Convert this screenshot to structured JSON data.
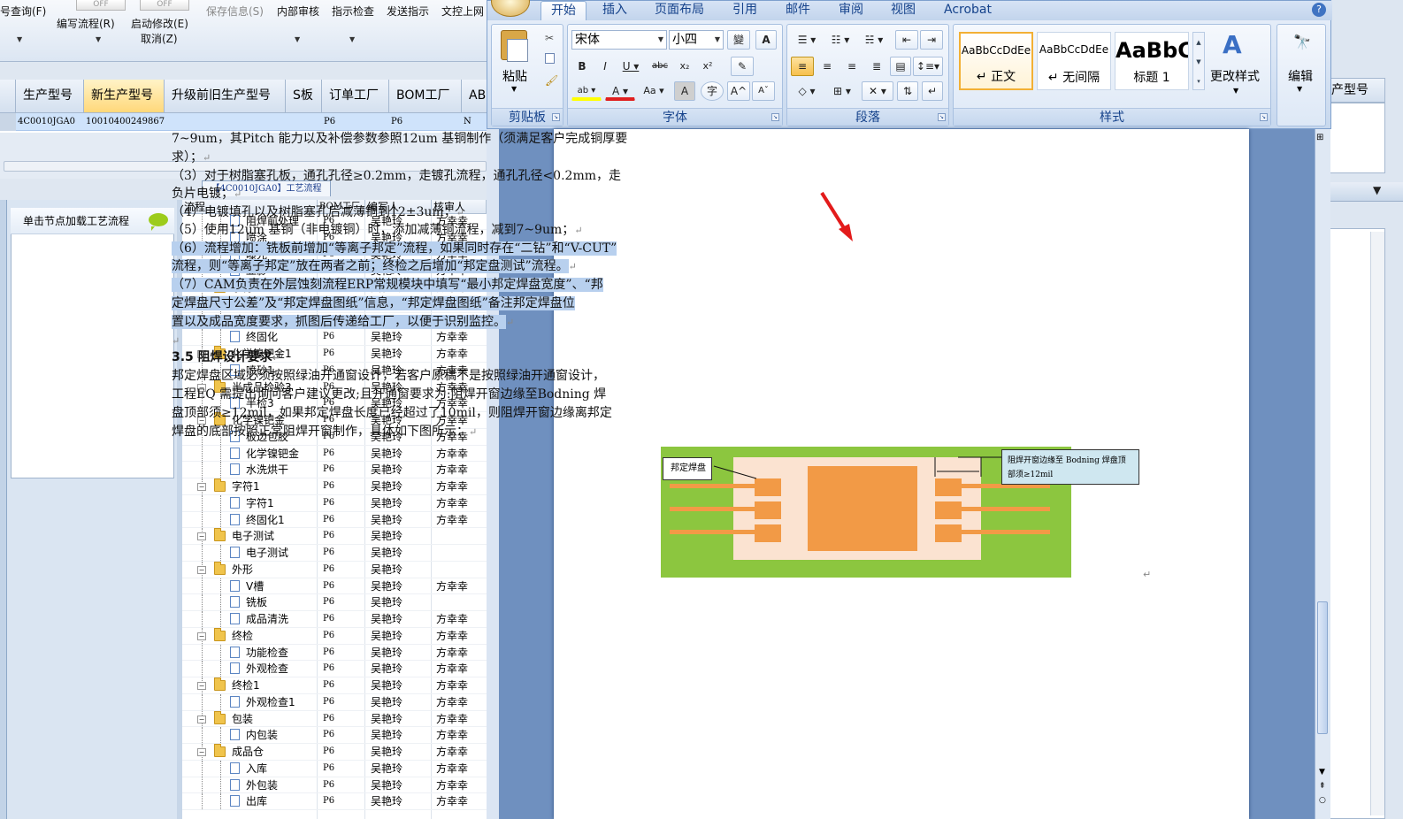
{
  "erp_toolbar": {
    "items": [
      {
        "label": "号查询(F)",
        "enabled": true
      },
      {
        "label": "编写流程(R)",
        "enabled": true
      },
      {
        "label": "启动修改(E)",
        "enabled": true
      },
      {
        "label": "取消(Z)",
        "enabled": true
      },
      {
        "label": "保存信息(S)",
        "enabled": false
      },
      {
        "label": "内部审核",
        "enabled": true
      },
      {
        "label": "指示检查",
        "enabled": true
      },
      {
        "label": "发送指示",
        "enabled": true
      },
      {
        "label": "文控上网",
        "enabled": true
      }
    ],
    "toggle_off_1": "OFF",
    "toggle_off_2": "OFF"
  },
  "top_grid": {
    "columns": [
      "生产型号",
      "新生产型号",
      "升级前旧生产型号",
      "S板",
      "订单工厂",
      "BOM工厂",
      "AB"
    ],
    "row": [
      "4C0010JGA0",
      "10010400249867",
      "",
      "",
      "P6",
      "P6",
      "N"
    ]
  },
  "process_tab": "【4C0010JGA0】工艺流程",
  "load_panel": {
    "title": "单击节点加载工艺流程"
  },
  "tree": {
    "columns": [
      "流程",
      "BOM工厂",
      "编写人",
      "核审人"
    ],
    "rows": [
      {
        "level": 2,
        "type": "doc",
        "name": "阻焊前处理",
        "factory": "P6",
        "writer": "吴艳玲",
        "reviewer": "方幸幸"
      },
      {
        "level": 2,
        "type": "doc",
        "name": "喷涂",
        "factory": "P6",
        "writer": "吴艳玲",
        "reviewer": "方幸幸"
      },
      {
        "level": 2,
        "type": "doc",
        "name": "曝光",
        "factory": "P6",
        "writer": "吴艳玲",
        "reviewer": "方幸幸"
      },
      {
        "level": 2,
        "type": "doc",
        "name": "显影",
        "factory": "P6",
        "writer": "吴艳玲",
        "reviewer": "方幸幸"
      },
      {
        "level": 1,
        "type": "folder",
        "name": "字符",
        "factory": "P6",
        "writer": "吴艳玲",
        "reviewer": "方幸幸"
      },
      {
        "level": 2,
        "type": "doc",
        "name": "字符",
        "factory": "P6",
        "writer": "吴艳玲",
        "reviewer": "方幸幸"
      },
      {
        "level": 2,
        "type": "doc",
        "name": "印序列号",
        "factory": "P6",
        "writer": "吴艳玲",
        "reviewer": "方幸幸"
      },
      {
        "level": 2,
        "type": "doc",
        "name": "终固化",
        "factory": "P6",
        "writer": "吴艳玲",
        "reviewer": "方幸幸"
      },
      {
        "level": 1,
        "type": "folder",
        "name": "化学镍钯金1",
        "factory": "P6",
        "writer": "吴艳玲",
        "reviewer": "方幸幸"
      },
      {
        "level": 2,
        "type": "doc",
        "name": "喷砂1",
        "factory": "P6",
        "writer": "吴艳玲",
        "reviewer": "方幸幸"
      },
      {
        "level": 1,
        "type": "folder",
        "name": "半成品检验3",
        "factory": "P6",
        "writer": "吴艳玲",
        "reviewer": "方幸幸"
      },
      {
        "level": 2,
        "type": "doc",
        "name": "半检3",
        "factory": "P6",
        "writer": "吴艳玲",
        "reviewer": "方幸幸"
      },
      {
        "level": 1,
        "type": "folder",
        "name": "化学镍钯金",
        "factory": "P6",
        "writer": "吴艳玲",
        "reviewer": "方幸幸"
      },
      {
        "level": 2,
        "type": "doc",
        "name": "板边包胶",
        "factory": "P6",
        "writer": "吴艳玲",
        "reviewer": "方幸幸"
      },
      {
        "level": 2,
        "type": "doc",
        "name": "化学镍钯金",
        "factory": "P6",
        "writer": "吴艳玲",
        "reviewer": "方幸幸"
      },
      {
        "level": 2,
        "type": "doc",
        "name": "水洗烘干",
        "factory": "P6",
        "writer": "吴艳玲",
        "reviewer": "方幸幸"
      },
      {
        "level": 1,
        "type": "folder",
        "name": "字符1",
        "factory": "P6",
        "writer": "吴艳玲",
        "reviewer": "方幸幸"
      },
      {
        "level": 2,
        "type": "doc",
        "name": "字符1",
        "factory": "P6",
        "writer": "吴艳玲",
        "reviewer": "方幸幸"
      },
      {
        "level": 2,
        "type": "doc",
        "name": "终固化1",
        "factory": "P6",
        "writer": "吴艳玲",
        "reviewer": "方幸幸"
      },
      {
        "level": 1,
        "type": "folder",
        "name": "电子测试",
        "factory": "P6",
        "writer": "吴艳玲",
        "reviewer": ""
      },
      {
        "level": 2,
        "type": "doc",
        "name": "电子测试",
        "factory": "P6",
        "writer": "吴艳玲",
        "reviewer": ""
      },
      {
        "level": 1,
        "type": "folder",
        "name": "外形",
        "factory": "P6",
        "writer": "吴艳玲",
        "reviewer": ""
      },
      {
        "level": 2,
        "type": "doc",
        "name": "V槽",
        "factory": "P6",
        "writer": "吴艳玲",
        "reviewer": "方幸幸"
      },
      {
        "level": 2,
        "type": "doc",
        "name": "铣板",
        "factory": "P6",
        "writer": "吴艳玲",
        "reviewer": ""
      },
      {
        "level": 2,
        "type": "doc",
        "name": "成品清洗",
        "factory": "P6",
        "writer": "吴艳玲",
        "reviewer": "方幸幸"
      },
      {
        "level": 1,
        "type": "folder",
        "name": "终检",
        "factory": "P6",
        "writer": "吴艳玲",
        "reviewer": "方幸幸"
      },
      {
        "level": 2,
        "type": "doc",
        "name": "功能检查",
        "factory": "P6",
        "writer": "吴艳玲",
        "reviewer": "方幸幸"
      },
      {
        "level": 2,
        "type": "doc",
        "name": "外观检查",
        "factory": "P6",
        "writer": "吴艳玲",
        "reviewer": "方幸幸"
      },
      {
        "level": 1,
        "type": "folder",
        "name": "终检1",
        "factory": "P6",
        "writer": "吴艳玲",
        "reviewer": "方幸幸"
      },
      {
        "level": 2,
        "type": "doc",
        "name": "外观检查1",
        "factory": "P6",
        "writer": "吴艳玲",
        "reviewer": "方幸幸"
      },
      {
        "level": 1,
        "type": "folder",
        "name": "包装",
        "factory": "P6",
        "writer": "吴艳玲",
        "reviewer": "方幸幸"
      },
      {
        "level": 2,
        "type": "doc",
        "name": "内包装",
        "factory": "P6",
        "writer": "吴艳玲",
        "reviewer": "方幸幸"
      },
      {
        "level": 1,
        "type": "folder",
        "name": "成品仓",
        "factory": "P6",
        "writer": "吴艳玲",
        "reviewer": "方幸幸"
      },
      {
        "level": 2,
        "type": "doc",
        "name": "入库",
        "factory": "P6",
        "writer": "吴艳玲",
        "reviewer": "方幸幸"
      },
      {
        "level": 2,
        "type": "doc",
        "name": "外包装",
        "factory": "P6",
        "writer": "吴艳玲",
        "reviewer": "方幸幸"
      },
      {
        "level": 2,
        "type": "doc",
        "name": "出库",
        "factory": "P6",
        "writer": "吴艳玲",
        "reviewer": "方幸幸"
      }
    ]
  },
  "right_strip": {
    "header": "产型号"
  },
  "word": {
    "tabs": [
      "开始",
      "插入",
      "页面布局",
      "引用",
      "邮件",
      "审阅",
      "视图",
      "Acrobat"
    ],
    "active_tab": "开始",
    "clipboard": {
      "paste_label": "粘贴",
      "group_label": "剪贴板"
    },
    "font": {
      "name": "宋体",
      "size": "小四",
      "group_label": "字体"
    },
    "paragraph": {
      "group_label": "段落"
    },
    "styles": {
      "items": [
        {
          "sample": "AaBbCcDdEe",
          "name": "↵ 正文"
        },
        {
          "sample": "AaBbCcDdEe",
          "name": "↵ 无间隔"
        },
        {
          "sample": "AaBbC",
          "name": "标题 1"
        }
      ],
      "change_styles_label": "更改样式",
      "group_label": "样式"
    },
    "editing": {
      "label": "编辑"
    },
    "doc": {
      "lines": [
        "7~9um，其Pitch 能力以及补偿参数参照12um 基铜制作（须满足客户完成铜厚要",
        "求）；",
        "（3）对于树脂塞孔板，通孔孔径≥0.2mm，走镀孔流程，通孔孔径<0.2mm，走",
        "负片电镀；",
        "（4）电镀填孔以及树脂塞孔后减薄铜到12±3um；",
        "（5）使用12um 基铜（非电镀铜）时，添加减薄铜流程，减到7~9um；",
        "（6）流程增加：铣板前增加“等离子邦定”流程，如果同时存在“二钻”和“V-CUT”",
        "流程，则“等离子邦定”放在两者之前；终检之后增加“邦定盘测试”流程。",
        "（7）CAM负责在外层蚀刻流程ERP常规模块中填写“最小邦定焊盘宽度”、“邦",
        "定焊盘尺寸公差”及“邦定焊盘图纸”信息，“邦定焊盘图纸”备注邦定焊盘位",
        "置以及成品宽度要求，抓图后传递给工厂，以便于识别监控。",
        "",
        "3.5  阻焊设计要求",
        "邦定焊盘区域必须按照绿油开通窗设计，若客户原稿不是按照绿油开通窗设计，",
        "工程EQ 需提出询问客户建议更改;且开通窗要求为:阻焊开窗边缘至Bodning 焊",
        "盘顶部须≥12mil，如果邦定焊盘长度已经超过了10mil，则阻焊开窗边缘离邦定",
        "焊盘的底部按照正常阻焊开窗制作，具体如下图所示："
      ],
      "figure": {
        "label_left": "邦定焊盘",
        "label_right": "阻焊开窗边缘至 Bodning 焊盘顶部须≥12mil"
      }
    }
  }
}
